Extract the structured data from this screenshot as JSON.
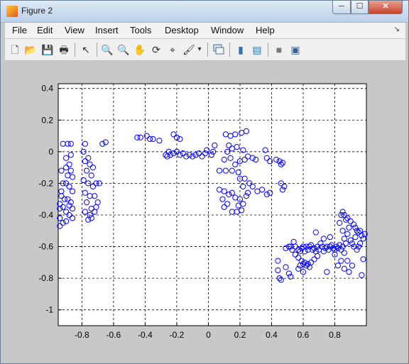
{
  "window": {
    "title": "Figure 2"
  },
  "controls": {
    "minimize": "─",
    "maximize": "☐",
    "close": "✕"
  },
  "menu": {
    "items": [
      "File",
      "Edit",
      "View",
      "Insert",
      "Tools",
      "Desktop",
      "Window",
      "Help"
    ],
    "arrow": "↘"
  },
  "toolbar": {
    "icons": [
      "new-figure",
      "open-file",
      "save",
      "print",
      "edit-plot",
      "zoom-in",
      "zoom-out",
      "pan",
      "rotate-3d",
      "data-cursor",
      "brush",
      "link",
      "insert-colorbar",
      "insert-legend",
      "hide-plot-tools",
      "show-plot-tools"
    ],
    "glyphs": [
      "🗋",
      "📂",
      "💾",
      "🖶",
      "↖",
      "🔍",
      "🔍",
      "✋",
      "⟳",
      "⌖",
      "🖌",
      "▾",
      "▮",
      "▤",
      "■",
      "▣"
    ]
  },
  "chart_data": {
    "type": "scatter",
    "title": "",
    "xlabel": "",
    "ylabel": "",
    "xlim": [
      -0.95,
      1.0
    ],
    "ylim": [
      -1.1,
      0.43
    ],
    "xticks": [
      -0.8,
      -0.6,
      -0.4,
      -0.2,
      0,
      0.2,
      0.4,
      0.6,
      0.8
    ],
    "yticks": [
      0.4,
      0.2,
      0,
      -0.2,
      -0.4,
      -0.6,
      -0.8,
      -1
    ],
    "grid": "dashed",
    "marker": "circle",
    "color": "#0000ff",
    "series": [
      {
        "points": [
          [
            -0.92,
            0.05
          ],
          [
            -0.89,
            0.05
          ],
          [
            -0.87,
            0.05
          ],
          [
            -0.93,
            -0.12
          ],
          [
            -0.9,
            -0.1
          ],
          [
            -0.88,
            -0.08
          ],
          [
            -0.87,
            -0.12
          ],
          [
            -0.86,
            -0.16
          ],
          [
            -0.9,
            -0.2
          ],
          [
            -0.88,
            -0.22
          ],
          [
            -0.86,
            -0.25
          ],
          [
            -0.93,
            -0.25
          ],
          [
            -0.91,
            -0.3
          ],
          [
            -0.89,
            -0.3
          ],
          [
            -0.87,
            -0.32
          ],
          [
            -0.94,
            -0.33
          ],
          [
            -0.92,
            -0.35
          ],
          [
            -0.9,
            -0.38
          ],
          [
            -0.88,
            -0.4
          ],
          [
            -0.86,
            -0.42
          ],
          [
            -0.94,
            -0.42
          ],
          [
            -0.92,
            -0.45
          ],
          [
            -0.9,
            -0.44
          ],
          [
            -0.94,
            -0.47
          ],
          [
            -0.92,
            -0.2
          ],
          [
            -0.89,
            -0.15
          ],
          [
            -0.87,
            -0.02
          ],
          [
            -0.9,
            -0.04
          ],
          [
            -0.94,
            -0.36
          ],
          [
            -0.86,
            -0.36
          ],
          [
            -0.88,
            -0.34
          ],
          [
            -0.93,
            -0.28
          ],
          [
            -0.78,
            0.05
          ],
          [
            -0.79,
            0.0
          ],
          [
            -0.78,
            -0.06
          ],
          [
            -0.75,
            -0.08
          ],
          [
            -0.77,
            -0.12
          ],
          [
            -0.74,
            -0.15
          ],
          [
            -0.79,
            -0.18
          ],
          [
            -0.76,
            -0.2
          ],
          [
            -0.73,
            -0.22
          ],
          [
            -0.71,
            -0.2
          ],
          [
            -0.69,
            -0.2
          ],
          [
            -0.78,
            -0.26
          ],
          [
            -0.75,
            -0.28
          ],
          [
            -0.72,
            -0.28
          ],
          [
            -0.77,
            -0.32
          ],
          [
            -0.74,
            -0.36
          ],
          [
            -0.71,
            -0.35
          ],
          [
            -0.78,
            -0.38
          ],
          [
            -0.75,
            -0.4
          ],
          [
            -0.72,
            -0.38
          ],
          [
            -0.76,
            -0.43
          ],
          [
            -0.74,
            -0.42
          ],
          [
            -0.7,
            -0.32
          ],
          [
            -0.73,
            -0.1
          ],
          [
            -0.76,
            -0.04
          ],
          [
            -0.67,
            0.05
          ],
          [
            -0.65,
            0.06
          ],
          [
            -0.45,
            0.09
          ],
          [
            -0.43,
            0.09
          ],
          [
            -0.39,
            0.1
          ],
          [
            -0.37,
            0.08
          ],
          [
            -0.35,
            0.08
          ],
          [
            -0.31,
            0.07
          ],
          [
            -0.22,
            0.11
          ],
          [
            -0.2,
            0.09
          ],
          [
            -0.18,
            0.08
          ],
          [
            -0.27,
            -0.02
          ],
          [
            -0.26,
            -0.03
          ],
          [
            -0.25,
            0.0
          ],
          [
            -0.24,
            -0.02
          ],
          [
            -0.22,
            -0.01
          ],
          [
            -0.2,
            0.0
          ],
          [
            -0.18,
            -0.02
          ],
          [
            -0.16,
            -0.01
          ],
          [
            -0.14,
            -0.03
          ],
          [
            -0.12,
            -0.02
          ],
          [
            -0.1,
            -0.03
          ],
          [
            -0.08,
            -0.02
          ],
          [
            -0.06,
            -0.01
          ],
          [
            -0.04,
            -0.03
          ],
          [
            -0.02,
            -0.01
          ],
          [
            -0.01,
            0.01
          ],
          [
            0.02,
            -0.02
          ],
          [
            0.04,
            0.04
          ],
          [
            0.03,
            0.0
          ],
          [
            0.11,
            0.11
          ],
          [
            0.14,
            0.1
          ],
          [
            0.17,
            0.11
          ],
          [
            0.21,
            0.12
          ],
          [
            0.24,
            0.13
          ],
          [
            0.13,
            0.04
          ],
          [
            0.18,
            0.03
          ],
          [
            0.22,
            0.01
          ],
          [
            0.12,
            0.0
          ],
          [
            0.1,
            -0.05
          ],
          [
            0.14,
            -0.04
          ],
          [
            0.17,
            -0.08
          ],
          [
            0.2,
            -0.06
          ],
          [
            0.23,
            -0.05
          ],
          [
            0.25,
            -0.03
          ],
          [
            0.28,
            -0.04
          ],
          [
            0.3,
            -0.05
          ],
          [
            0.15,
            0.02
          ],
          [
            0.07,
            -0.12
          ],
          [
            0.11,
            -0.12
          ],
          [
            0.15,
            -0.12
          ],
          [
            0.19,
            -0.13
          ],
          [
            0.2,
            -0.17
          ],
          [
            0.23,
            -0.17
          ],
          [
            0.26,
            -0.2
          ],
          [
            0.28,
            -0.22
          ],
          [
            0.31,
            -0.25
          ],
          [
            0.34,
            -0.24
          ],
          [
            0.37,
            -0.27
          ],
          [
            0.39,
            -0.26
          ],
          [
            0.07,
            -0.24
          ],
          [
            0.1,
            -0.25
          ],
          [
            0.13,
            -0.27
          ],
          [
            0.15,
            -0.26
          ],
          [
            0.09,
            -0.3
          ],
          [
            0.12,
            -0.33
          ],
          [
            0.1,
            -0.35
          ],
          [
            0.15,
            -0.38
          ],
          [
            0.18,
            -0.38
          ],
          [
            0.21,
            -0.37
          ],
          [
            0.22,
            -0.33
          ],
          [
            0.24,
            -0.28
          ],
          [
            0.22,
            -0.22
          ],
          [
            0.25,
            -0.26
          ],
          [
            0.2,
            -0.3
          ],
          [
            0.19,
            -0.34
          ],
          [
            0.17,
            -0.29
          ],
          [
            0.36,
            0.01
          ],
          [
            0.37,
            -0.04
          ],
          [
            0.39,
            -0.06
          ],
          [
            0.43,
            -0.05
          ],
          [
            0.45,
            -0.06
          ],
          [
            0.46,
            -0.08
          ],
          [
            0.47,
            -0.07
          ],
          [
            0.46,
            -0.2
          ],
          [
            0.48,
            -0.22
          ],
          [
            0.47,
            -0.24
          ],
          [
            0.49,
            -0.61
          ],
          [
            0.51,
            -0.6
          ],
          [
            0.52,
            -0.6
          ],
          [
            0.53,
            -0.62
          ],
          [
            0.54,
            -0.57
          ],
          [
            0.55,
            -0.6
          ],
          [
            0.57,
            -0.62
          ],
          [
            0.58,
            -0.63
          ],
          [
            0.59,
            -0.61
          ],
          [
            0.6,
            -0.6
          ],
          [
            0.61,
            -0.63
          ],
          [
            0.62,
            -0.6
          ],
          [
            0.63,
            -0.62
          ],
          [
            0.64,
            -0.6
          ],
          [
            0.65,
            -0.59
          ],
          [
            0.66,
            -0.62
          ],
          [
            0.67,
            -0.61
          ],
          [
            0.68,
            -0.63
          ],
          [
            0.69,
            -0.6
          ],
          [
            0.7,
            -0.62
          ],
          [
            0.71,
            -0.58
          ],
          [
            0.72,
            -0.6
          ],
          [
            0.73,
            -0.63
          ],
          [
            0.74,
            -0.61
          ],
          [
            0.75,
            -0.6
          ],
          [
            0.76,
            -0.62
          ],
          [
            0.77,
            -0.6
          ],
          [
            0.78,
            -0.59
          ],
          [
            0.79,
            -0.61
          ],
          [
            0.8,
            -0.62
          ],
          [
            0.81,
            -0.6
          ],
          [
            0.82,
            -0.61
          ],
          [
            0.83,
            -0.59
          ],
          [
            0.84,
            -0.62
          ],
          [
            0.85,
            -0.6
          ],
          [
            0.55,
            -0.65
          ],
          [
            0.57,
            -0.67
          ],
          [
            0.59,
            -0.69
          ],
          [
            0.6,
            -0.71
          ],
          [
            0.61,
            -0.7
          ],
          [
            0.62,
            -0.72
          ],
          [
            0.63,
            -0.71
          ],
          [
            0.65,
            -0.7
          ],
          [
            0.67,
            -0.68
          ],
          [
            0.69,
            -0.66
          ],
          [
            0.58,
            -0.72
          ],
          [
            0.64,
            -0.73
          ],
          [
            0.45,
            -0.8
          ],
          [
            0.46,
            -0.81
          ],
          [
            0.44,
            -0.75
          ],
          [
            0.44,
            -0.69
          ],
          [
            0.49,
            -0.73
          ],
          [
            0.51,
            -0.77
          ],
          [
            0.52,
            -0.79
          ],
          [
            0.57,
            -0.74
          ],
          [
            0.6,
            -0.76
          ],
          [
            0.75,
            -0.76
          ],
          [
            0.68,
            -0.51
          ],
          [
            0.77,
            -0.54
          ],
          [
            0.73,
            -0.55
          ],
          [
            0.86,
            -0.64
          ],
          [
            0.84,
            -0.4
          ],
          [
            0.85,
            -0.38
          ],
          [
            0.86,
            -0.4
          ],
          [
            0.87,
            -0.43
          ],
          [
            0.88,
            -0.42
          ],
          [
            0.9,
            -0.44
          ],
          [
            0.92,
            -0.46
          ],
          [
            0.93,
            -0.48
          ],
          [
            0.94,
            -0.5
          ],
          [
            0.95,
            -0.51
          ],
          [
            0.96,
            -0.5
          ],
          [
            0.97,
            -0.53
          ],
          [
            0.98,
            -0.55
          ],
          [
            0.99,
            -0.52
          ],
          [
            0.83,
            -0.45
          ],
          [
            0.85,
            -0.5
          ],
          [
            0.86,
            -0.55
          ],
          [
            0.88,
            -0.52
          ],
          [
            0.9,
            -0.56
          ],
          [
            0.91,
            -0.58
          ],
          [
            0.92,
            -0.6
          ],
          [
            0.94,
            -0.62
          ],
          [
            0.95,
            -0.6
          ],
          [
            0.96,
            -0.58
          ],
          [
            0.89,
            -0.48
          ],
          [
            0.87,
            -0.58
          ],
          [
            0.93,
            -0.54
          ],
          [
            0.98,
            -0.68
          ],
          [
            0.97,
            -0.78
          ],
          [
            0.91,
            -0.72
          ],
          [
            0.89,
            -0.76
          ],
          [
            0.86,
            -0.74
          ],
          [
            0.88,
            -0.69
          ],
          [
            0.84,
            -0.69
          ],
          [
            0.82,
            -0.72
          ],
          [
            0.8,
            -0.65
          ]
        ]
      }
    ]
  }
}
